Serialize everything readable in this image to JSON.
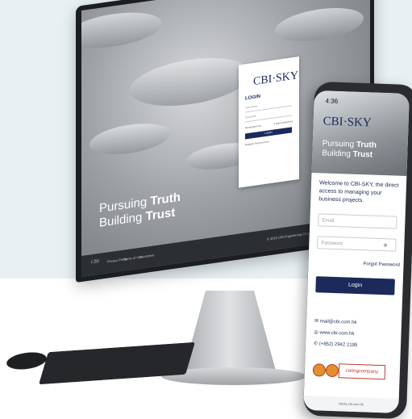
{
  "desktop": {
    "tagline_line1": "Pursuing",
    "tagline_line1_bold": "Truth",
    "tagline_line2": "Building",
    "tagline_line2_bold": "Trust",
    "login": {
      "logo": "CBI·SKY",
      "title": "LOGIN",
      "username_placeholder": "User Name",
      "password_placeholder": "Password",
      "remember_label": "Remember me",
      "forgot_label": "Forgot Password",
      "login_button": "LOGIN",
      "register_label": "Register New Account"
    },
    "footer": {
      "logo": "CBI",
      "links": [
        "Privacy Policy",
        "Terms of Use",
        "Disclaimer"
      ],
      "copyright": "© 2022 CBI Engineering Co Limited. All rights reserved."
    }
  },
  "phone": {
    "status_time": "4:36",
    "logo": "CBI·SKY",
    "tagline_line1": "Pursuing",
    "tagline_line1_bold": "Truth",
    "tagline_line2": "Building",
    "tagline_line2_bold": "Trust",
    "welcome_text": "Welcome to CBI-SKY, the direct access to managing your business projects.",
    "email_placeholder": "Email",
    "password_placeholder": "Password",
    "forgot_label": "Forgot Password",
    "login_button": "Login",
    "contact": {
      "email": "mail@cbi.com.hk",
      "website": "www.cbi.com.hk",
      "phone": "(+852) 2942 2195"
    },
    "badges": [
      "ISO",
      "ISO"
    ],
    "caring_company": "caringcompany",
    "bottom_url": "cbisky.cbi.com.hk"
  },
  "colors": {
    "brand_navy": "#1b2a5a",
    "background_band": "#e8f0f4",
    "badge_orange": "#e0902c",
    "badge_red": "#c0392b"
  }
}
